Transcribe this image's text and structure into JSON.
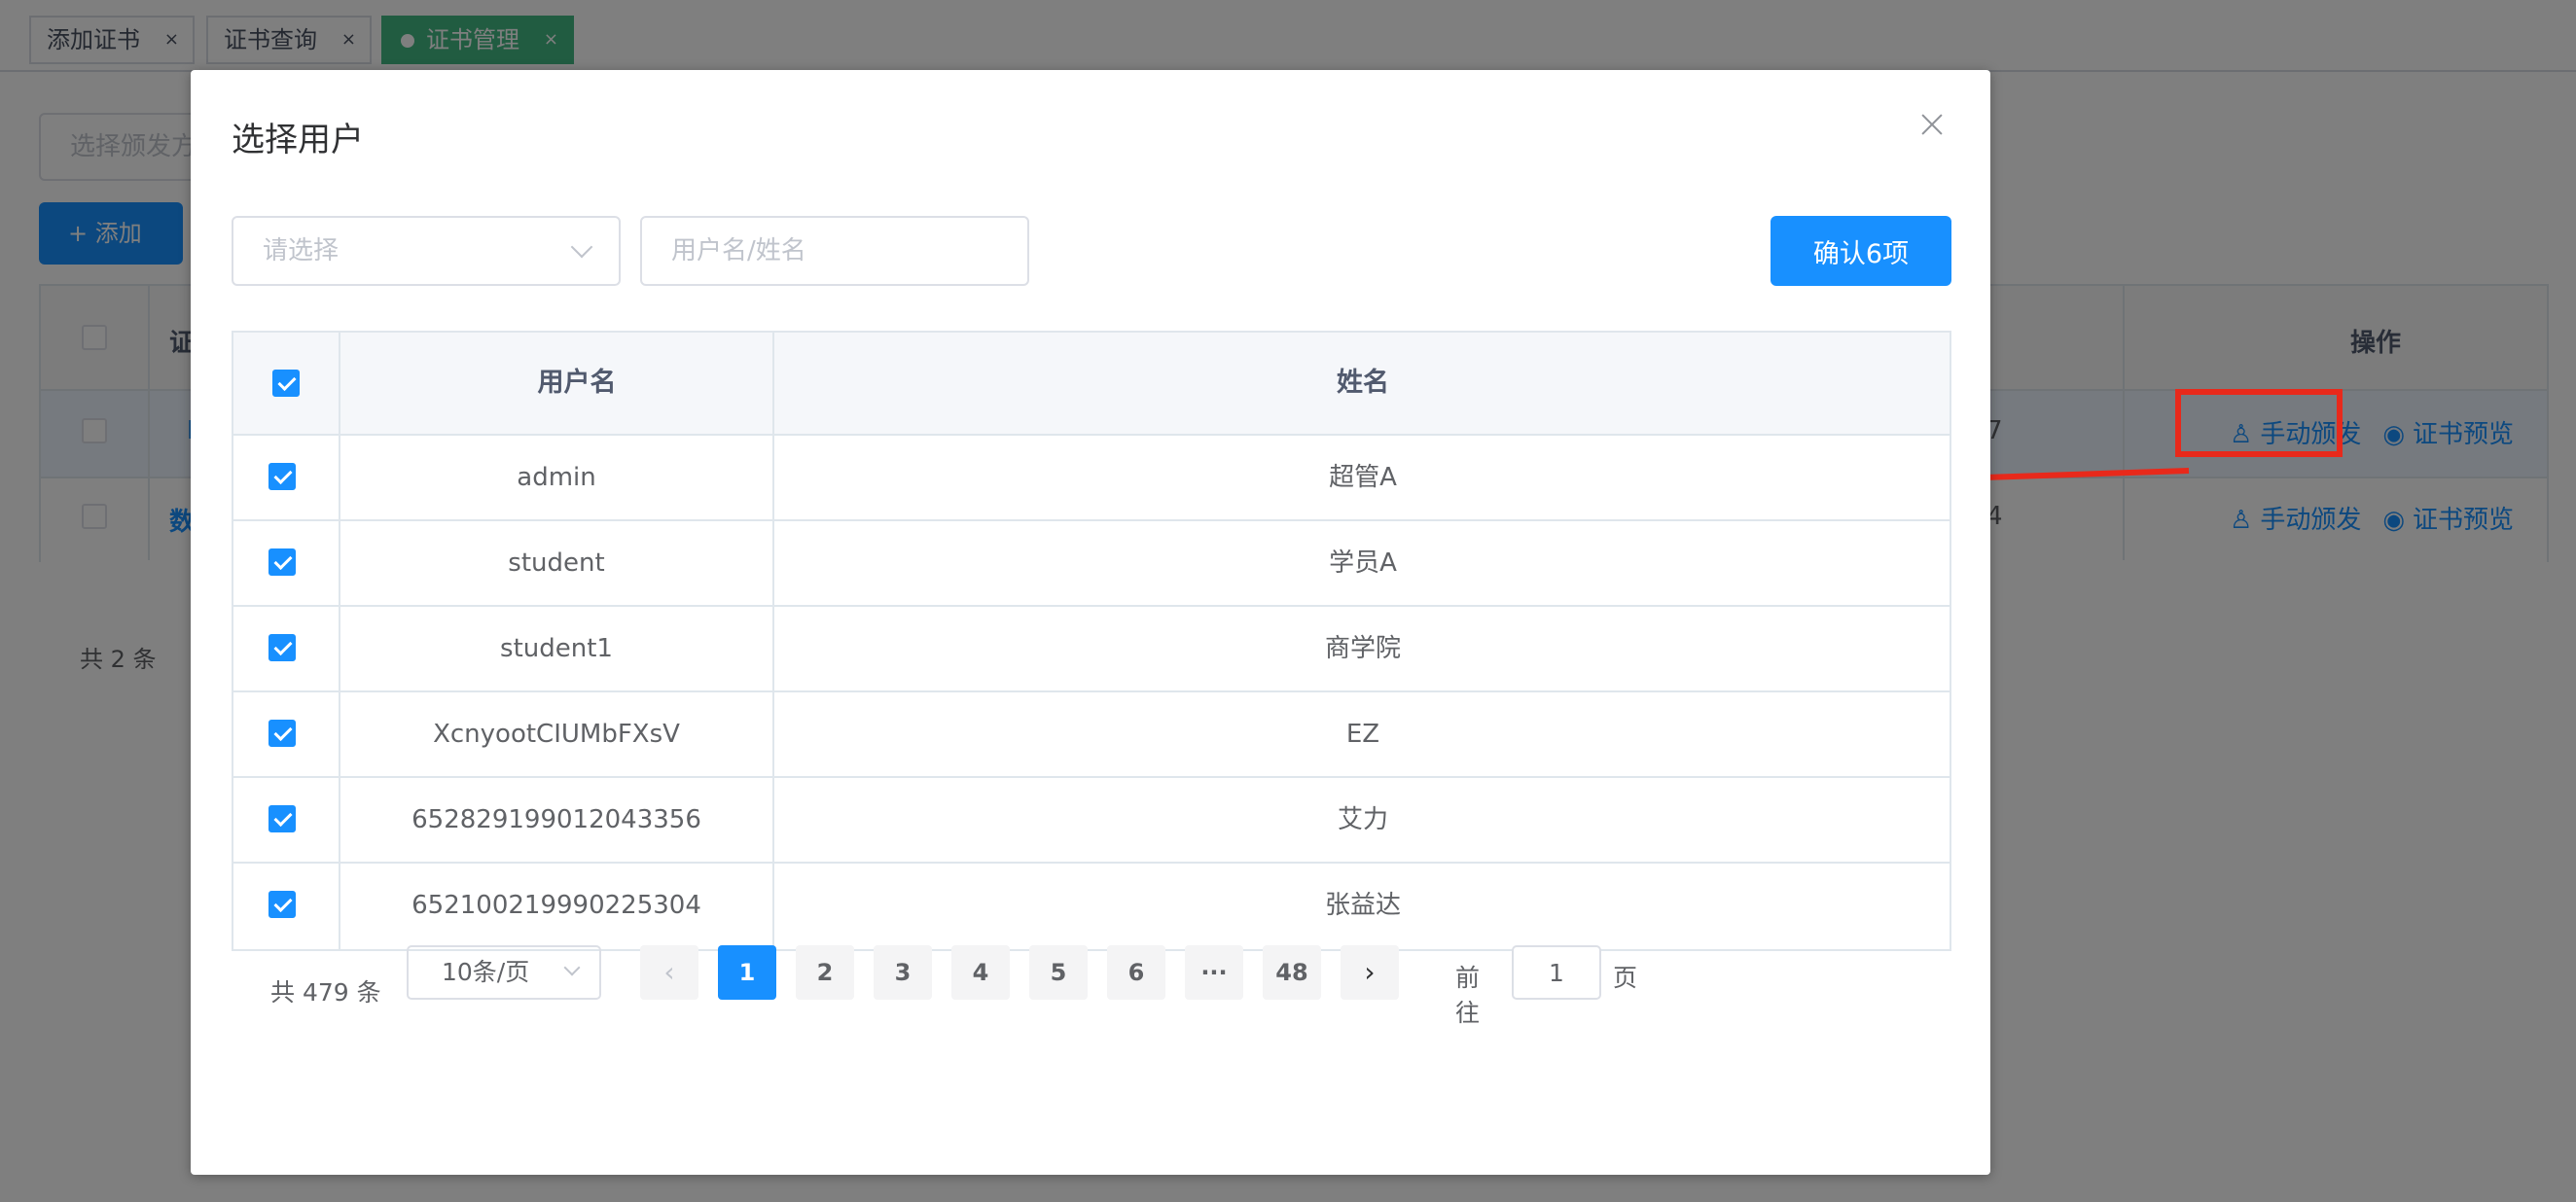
{
  "tabs": [
    {
      "label": "添加证书",
      "close": "×"
    },
    {
      "label": "证书查询",
      "close": "×"
    },
    {
      "label": "证书管理",
      "close": "×",
      "active": true
    }
  ],
  "background": {
    "select_placeholder": "选择颁发方",
    "add_button": "+ 添加",
    "header_fragment": "证",
    "row1_fragment": "I",
    "row2_fragment": "数",
    "row1_tail": "7",
    "row2_tail": "4",
    "operation_header": "操作",
    "manual_issue": "手动颁发",
    "preview": "证书预览",
    "total": "共 2 条"
  },
  "dialog": {
    "title": "选择用户",
    "select_placeholder": "请选择",
    "keyword_placeholder": "用户名/姓名",
    "confirm_button": "确认6项",
    "columns": {
      "username": "用户名",
      "name": "姓名"
    },
    "rows": [
      {
        "username": "admin",
        "name": "超管A",
        "checked": true
      },
      {
        "username": "student",
        "name": "学员A",
        "checked": true
      },
      {
        "username": "student1",
        "name": "商学院",
        "checked": true
      },
      {
        "username": "XcnyootCIUMbFXsV",
        "name": "EZ",
        "checked": true
      },
      {
        "username": "652829199012043356",
        "name": "艾力",
        "checked": true
      },
      {
        "username": "652100219990225304",
        "name": "张益达",
        "checked": true
      }
    ],
    "pagination": {
      "total_text": "共 479 条",
      "page_size": "10条/页",
      "pages": [
        "1",
        "2",
        "3",
        "4",
        "5",
        "6",
        "···",
        "48"
      ],
      "current": "1",
      "prev": "‹",
      "next": "›",
      "goto_label": "前往",
      "goto_value": "1",
      "page_label": "页"
    }
  },
  "annotation_color": "#e8291b",
  "accent_color": "#1890ff"
}
